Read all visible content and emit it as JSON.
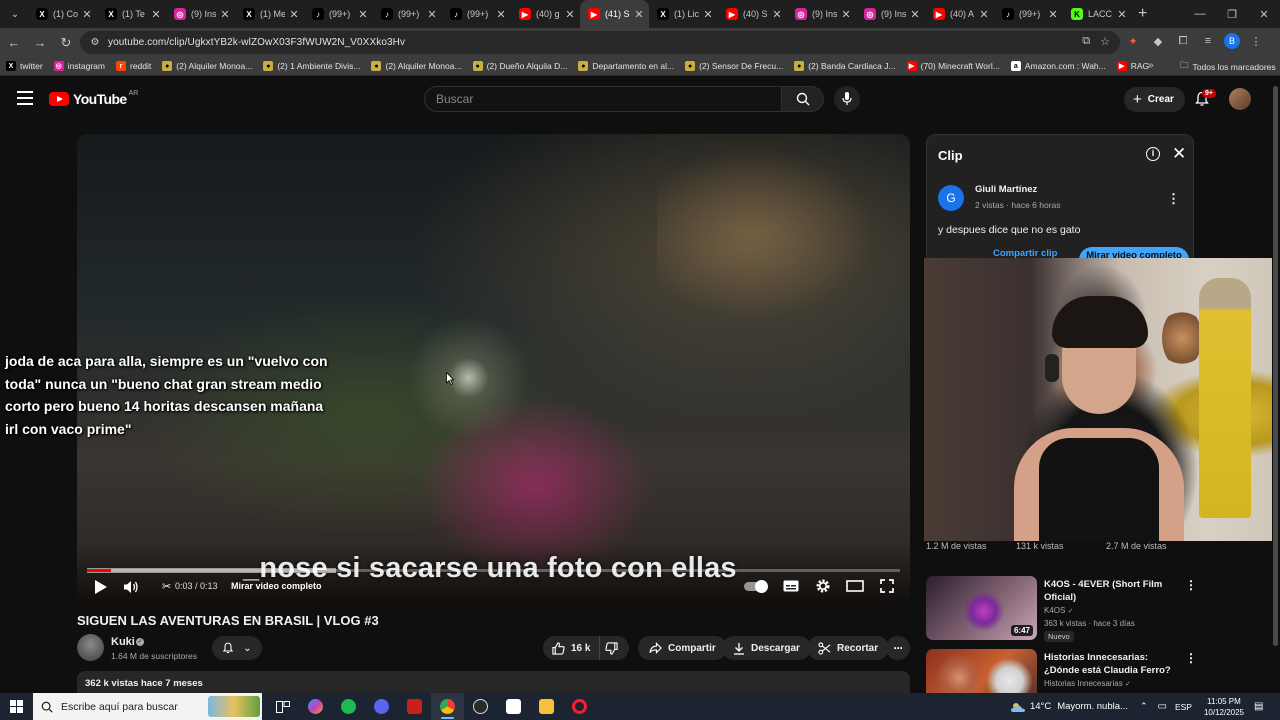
{
  "browser": {
    "tabs": [
      {
        "title": "(1) Co",
        "favicon": "x-icon",
        "fav_bg": "#000000",
        "fav_fg": "#ffffff",
        "fav_char": "X"
      },
      {
        "title": "(1) Te",
        "favicon": "x-icon",
        "fav_bg": "#000000",
        "fav_fg": "#ffffff",
        "fav_char": "X"
      },
      {
        "title": "(9) Ins",
        "favicon": "instagram-icon",
        "fav_bg": "#d6249f",
        "fav_fg": "#ffffff",
        "fav_char": "◎"
      },
      {
        "title": "(1) Me",
        "favicon": "x-icon",
        "fav_bg": "#000000",
        "fav_fg": "#ffffff",
        "fav_char": "X"
      },
      {
        "title": "(99+)",
        "favicon": "tiktok-icon",
        "fav_bg": "#000000",
        "fav_fg": "#ffffff",
        "fav_char": "♪"
      },
      {
        "title": "(99+)",
        "favicon": "tiktok-icon",
        "fav_bg": "#000000",
        "fav_fg": "#ffffff",
        "fav_char": "♪"
      },
      {
        "title": "(99+)",
        "favicon": "tiktok-icon",
        "fav_bg": "#000000",
        "fav_fg": "#ffffff",
        "fav_char": "♪"
      },
      {
        "title": "(40) g",
        "favicon": "youtube-icon",
        "fav_bg": "#ff0000",
        "fav_fg": "#ffffff",
        "fav_char": "▶"
      },
      {
        "title": "(41) SI",
        "favicon": "youtube-icon",
        "fav_bg": "#ff0000",
        "fav_fg": "#ffffff",
        "fav_char": "▶",
        "active": true
      },
      {
        "title": "(1) Lic",
        "favicon": "x-icon",
        "fav_bg": "#000000",
        "fav_fg": "#ffffff",
        "fav_char": "X"
      },
      {
        "title": "(40) S",
        "favicon": "youtube-icon",
        "fav_bg": "#ff0000",
        "fav_fg": "#ffffff",
        "fav_char": "▶"
      },
      {
        "title": "(9) Ins",
        "favicon": "instagram-icon",
        "fav_bg": "#d6249f",
        "fav_fg": "#ffffff",
        "fav_char": "◎"
      },
      {
        "title": "(9) Ins",
        "favicon": "instagram-icon",
        "fav_bg": "#d6249f",
        "fav_fg": "#ffffff",
        "fav_char": "◎"
      },
      {
        "title": "(40) A",
        "favicon": "youtube-icon",
        "fav_bg": "#ff0000",
        "fav_fg": "#ffffff",
        "fav_char": "▶"
      },
      {
        "title": "(99+)",
        "favicon": "tiktok-icon",
        "fav_bg": "#000000",
        "fav_fg": "#ffffff",
        "fav_char": "♪"
      },
      {
        "title": "LACC",
        "favicon": "kick-icon",
        "fav_bg": "#53fc18",
        "fav_fg": "#000000",
        "fav_char": "K"
      }
    ],
    "url": "youtube.com/clip/UgkxtYB2k-wlZOwX03F3fWUW2N_V0XXko3Hv",
    "profile_initial": "B",
    "bookmarks": [
      {
        "label": "twitter",
        "icon": "x-icon",
        "bg": "#000000",
        "char": "X"
      },
      {
        "label": "instagram",
        "icon": "instagram-icon",
        "bg": "#d6249f",
        "char": "◎"
      },
      {
        "label": "reddit",
        "icon": "reddit-icon",
        "bg": "#ff4500",
        "char": "r"
      },
      {
        "label": "(2) Alquiler Monoa...",
        "icon": "marketplace-icon",
        "bg": "#c8b040",
        "char": "●"
      },
      {
        "label": "(2) 1 Ambiente Divis...",
        "icon": "marketplace-icon",
        "bg": "#c8b040",
        "char": "●"
      },
      {
        "label": "(2) Alquiler Monoa...",
        "icon": "marketplace-icon",
        "bg": "#c8b040",
        "char": "●"
      },
      {
        "label": "(2) Dueño Alquila D...",
        "icon": "marketplace-icon",
        "bg": "#c8b040",
        "char": "●"
      },
      {
        "label": "Departamento en al...",
        "icon": "marketplace-icon",
        "bg": "#c8b040",
        "char": "●"
      },
      {
        "label": "(2) Sensor De Frecu...",
        "icon": "marketplace-icon",
        "bg": "#c8b040",
        "char": "●"
      },
      {
        "label": "(2) Banda Cardiaca J...",
        "icon": "marketplace-icon",
        "bg": "#c8b040",
        "char": "●"
      },
      {
        "label": "(70) Minecraft Worl...",
        "icon": "youtube-icon",
        "bg": "#ff0000",
        "char": "▶"
      },
      {
        "label": "Amazon.com : Wah...",
        "icon": "amazon-icon",
        "bg": "#ffffff",
        "char": "a"
      },
      {
        "label": "RAG",
        "icon": "youtube-icon",
        "bg": "#ff0000",
        "char": "▶"
      }
    ],
    "all_bookmarks": "Todos los marcadores"
  },
  "youtube": {
    "logo_text": "YouTube",
    "country": "AR",
    "search_placeholder": "Buscar",
    "create_label": "Crear",
    "notif_badge": "9+"
  },
  "player": {
    "overlay_chat": "joda de aca para alla, siempre es un \"vuelvo con toda\" nunca un \"bueno chat gran stream medio corto pero bueno 14 horitas descansen mañana irl con vaco prime\"",
    "subtitle": "_nose si sacarse una foto con ellas",
    "time": "0:03 / 0:13",
    "watch_full": "Mirar video completo",
    "progress": 0.03,
    "clip_start": 0.0,
    "clip_end": 0.03
  },
  "video": {
    "title": "SIGUEN LAS AVENTURAS EN BRASIL | VLOG #3",
    "channel": "Kuki",
    "subscribers": "1.64 M de suscriptores",
    "likes": "16 k",
    "share": "Compartir",
    "download": "Descargar",
    "clip": "Recortar",
    "description_meta": "362 k vistas  hace 7 meses"
  },
  "clip_panel": {
    "header": "Clip",
    "avatar_initial": "G",
    "author": "Giuli Martínez",
    "meta": "2 vistas · hace 6 horas",
    "comment": "y despues dice que no es gato",
    "share_clip": "Compartir clip",
    "watch_full": "Mirar video completo"
  },
  "cam_stats": [
    "1.2 M de vistas",
    "131 k vistas",
    "2.7 M de vistas"
  ],
  "recommendations": [
    {
      "title": "K4OS - 4EVER (Short Film Oficial)",
      "channel": "K4OS",
      "meta": "363 k vistas · hace 3 días",
      "badge": "Nuevo",
      "duration": "6:47"
    },
    {
      "title": "Historias Innecesarias: ¿Dónde está Claudia Ferro?",
      "channel": "Historias Innecesarias",
      "meta": "",
      "badge": "",
      "duration": ""
    }
  ],
  "taskbar": {
    "search_placeholder": "Escribe aquí para buscar",
    "temp": "14°C",
    "weather": "Mayorm. nubla...",
    "lang": "ESP",
    "time": "11:05 PM",
    "date": "10/12/2025"
  }
}
